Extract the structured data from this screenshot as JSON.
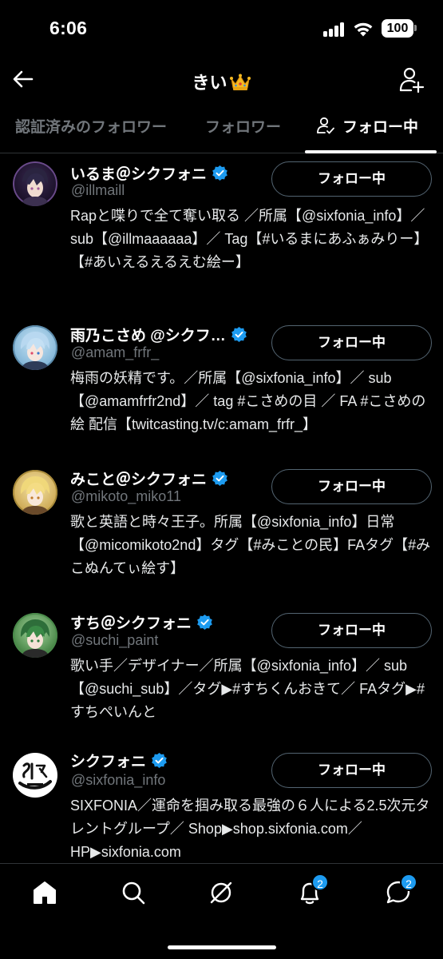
{
  "status_bar": {
    "time": "6:06",
    "battery": "100"
  },
  "header": {
    "title": "きい"
  },
  "tabs": [
    {
      "label": "認証済みのフォロワー"
    },
    {
      "label": "フォロワー"
    },
    {
      "label": "フォロー中"
    }
  ],
  "users": [
    {
      "name": "いるま＠シクフォニ",
      "handle": "@illmaill",
      "button": "フォロー中",
      "bio": "Rapと喋りで全て奪い取る ／所属【@sixfonia_info】／ sub【@illmaaaaaa】／ Tag【#いるまにあふぁみりー】【#あいえるえるえむ絵ー】"
    },
    {
      "name": "雨乃こさめ @シクフ…",
      "handle": "@amam_frfr_",
      "button": "フォロー中",
      "bio": "梅雨の妖精です。／所属【@sixfonia_info】／ sub【@amamfrfr2nd】／ tag #こさめの目 ／ FA #こさめの絵 配信【twitcasting.tv/c:amam_frfr_】"
    },
    {
      "name": "みこと＠シクフォニ",
      "handle": "@mikoto_miko11",
      "button": "フォロー中",
      "bio": "歌と英語と時々王子。所属【@sixfonia_info】日常【@micomikoto2nd】タグ【#みことの民】FAタグ【#みこぬんてぃ絵す】"
    },
    {
      "name": "すち＠シクフォニ",
      "handle": "@suchi_paint",
      "button": "フォロー中",
      "bio": "歌い手／デザイナー／所属【@sixfonia_info】／ sub【@suchi_sub】／タグ▶#すちくんおきて／ FAタグ▶#すちぺいんと"
    },
    {
      "name": "シクフォニ",
      "handle": "@sixfonia_info",
      "button": "フォロー中",
      "bio": "SIXFONIA／運命を掴み取る最強の６人による2.5次元タレントグループ／ Shop▶shop.sixfonia.com／HP▶sixfonia.com"
    }
  ],
  "bottom_nav": {
    "notifications_badge": "2",
    "messages_badge": "2"
  },
  "colors": {
    "accent": "#1d9bf0",
    "background": "#000000",
    "muted": "#71767b"
  },
  "icons": [
    "back-arrow-icon",
    "crown-emoji-icon",
    "add-user-icon",
    "person-check-icon",
    "verified-badge-icon",
    "home-icon",
    "search-icon",
    "grok-icon",
    "bell-icon",
    "messages-icon"
  ]
}
